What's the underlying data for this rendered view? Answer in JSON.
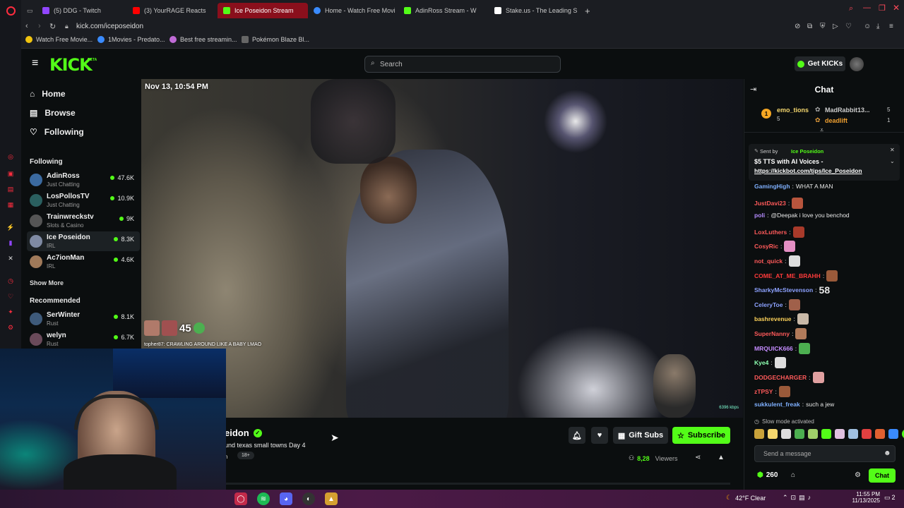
{
  "colors": {
    "kick_green": "#53fc18",
    "background": "#0b0e0f",
    "active_tab": "#8a0f1c"
  },
  "browser": {
    "tabs": [
      {
        "label": "(5) DDG - Twitch",
        "icon": "twitch-icon",
        "color": "#9146ff"
      },
      {
        "label": "(3) YourRAGE Reacts",
        "icon": "youtube-icon",
        "color": "#ff0000"
      },
      {
        "label": "Ice Poseidon Stream",
        "icon": "kick-icon",
        "color": "#53fc18"
      },
      {
        "label": "Home - Watch Free Movi",
        "icon": "globe-icon",
        "color": "#3a8bff"
      },
      {
        "label": "AdinRoss Stream - W",
        "icon": "kick-icon",
        "color": "#53fc18"
      },
      {
        "label": "Stake.us - The Leading S",
        "icon": "stake-icon",
        "color": "#ffffff"
      }
    ],
    "url": "kick.com/iceposeidon",
    "bookmarks": [
      {
        "label": "Watch Free Movie...",
        "color": "#f1c40f"
      },
      {
        "label": "1Movies - Predato...",
        "color": "#3a8bff"
      },
      {
        "label": "Best free streamin...",
        "color": "#c06bd6"
      },
      {
        "label": "Pokémon Blaze Bl...",
        "color": "#666666"
      }
    ]
  },
  "header": {
    "logo": "KICK",
    "logo_badge": "BETA",
    "search_placeholder": "Search",
    "get_kicks": "Get KICKs"
  },
  "sidebar": {
    "nav": [
      {
        "label": "Home",
        "icon": "home-icon"
      },
      {
        "label": "Browse",
        "icon": "browse-icon"
      },
      {
        "label": "Following",
        "icon": "heart-icon"
      }
    ],
    "following_title": "Following",
    "following": [
      {
        "name": "AdinRoss",
        "category": "Just Chatting",
        "viewers": "47.6K",
        "color": "#3b6aa0"
      },
      {
        "name": "LosPollosTV",
        "category": "Just Chatting",
        "viewers": "10.9K",
        "color": "#2a5f5f"
      },
      {
        "name": "Trainwreckstv",
        "category": "Slots & Casino",
        "viewers": "9K",
        "color": "#555555"
      },
      {
        "name": "Ice Poseidon",
        "category": "IRL",
        "viewers": "8.3K",
        "color": "#7f8aa3"
      },
      {
        "name": "Ac7ionMan",
        "category": "IRL",
        "viewers": "4.6K",
        "color": "#a07a5a"
      }
    ],
    "show_more": "Show More",
    "recommended_title": "Recommended",
    "recommended": [
      {
        "name": "SerWinter",
        "category": "Rust",
        "viewers": "8.1K",
        "color": "#3e5a7a"
      },
      {
        "name": "welyn",
        "category": "Rust",
        "viewers": "6.7K",
        "color": "#6a4a5a"
      }
    ]
  },
  "video": {
    "timestamp": "Nov 13, 10:54 PM",
    "overlay_count": "45",
    "overlay_caption": "topher87: CRAWLING AROUND LIKE A BABY LMAO",
    "bitrate": "6396 kbps"
  },
  "stream_info": {
    "channel_name_partial": "eidon",
    "title_partial": "und texas small towns Day 4",
    "tag_partial": "h",
    "age_tag": "18+",
    "viewers": "8,28",
    "viewers_label": "Viewers",
    "gift_subs": "Gift Subs",
    "subscribe": "Subscribe"
  },
  "chat": {
    "title": "Chat",
    "leaderboard": [
      {
        "rank": "1",
        "name": "emo_tions",
        "count": "5"
      },
      {
        "name": "MadRabbit13...",
        "count": "5"
      },
      {
        "name": "deadlift",
        "count": "1"
      }
    ],
    "pinned": {
      "sent_by_prefix": "Sent by",
      "sent_by": "Ice Poseidon",
      "line1": "$5 TTS with AI Voices -",
      "link": "https://kickbot.com/tips/Ice_Poseidon"
    },
    "messages": [
      {
        "user": "GamingHigh",
        "text": "WHAT A MAN",
        "color": "#7fb0ff",
        "emote": ""
      },
      {
        "user": "JustDavi23",
        "text": "",
        "color": "#ff5a5a",
        "emote": "#b8553d"
      },
      {
        "user": "poli",
        "text": "@Deepak i love you benchod",
        "color": "#b58cff",
        "emote": ""
      },
      {
        "user": "LoxLuthers",
        "text": "",
        "color": "#ff5a5a",
        "emote": "#a83a2a"
      },
      {
        "user": "CosyRic",
        "text": "",
        "color": "#ff5a5a",
        "emote": "#e48fc4"
      },
      {
        "user": "not_quick",
        "text": "",
        "color": "#ff5a5a",
        "emote": "#dddddd"
      },
      {
        "user": "COME_AT_ME_BRAHH",
        "text": "",
        "color": "#ff3b3b",
        "emote": "#9a5a3a"
      },
      {
        "user": "SharkyMcStevenson",
        "text": "58",
        "color": "#8da2ff",
        "emote": ""
      },
      {
        "user": "CeleryToe",
        "text": "",
        "color": "#8da2ff",
        "emote": "#a0604a"
      },
      {
        "user": "bashrevenue",
        "text": "",
        "color": "#ffd35a",
        "emote": "#c9b9a8"
      },
      {
        "user": "SuperNanny",
        "text": "",
        "color": "#ff5a5a",
        "emote": "#b07a5a"
      },
      {
        "user": "MRQUICK666",
        "text": "",
        "color": "#c58cff",
        "emote": "#4caf50"
      },
      {
        "user": "Kye4",
        "text": "",
        "color": "#8dffb0",
        "emote": "#dddddd"
      },
      {
        "user": "DODGECHARGER",
        "text": "",
        "color": "#ff5a5a",
        "emote": "#e0a0a0"
      },
      {
        "user": "zTPSY",
        "text": "",
        "color": "#ff5a5a",
        "emote": "#9a5a3a"
      },
      {
        "user": "sukkulent_freak",
        "text": "such a jew",
        "color": "#7fb0ff",
        "emote": ""
      }
    ],
    "slow_mode": "Slow mode activated",
    "placeholder": "Send a message",
    "kicks": "260",
    "chat_button": "Chat"
  },
  "taskbar": {
    "weather": "42°F  Clear",
    "time": "11:55 PM",
    "date": "11/13/2025",
    "notifications": "2"
  }
}
